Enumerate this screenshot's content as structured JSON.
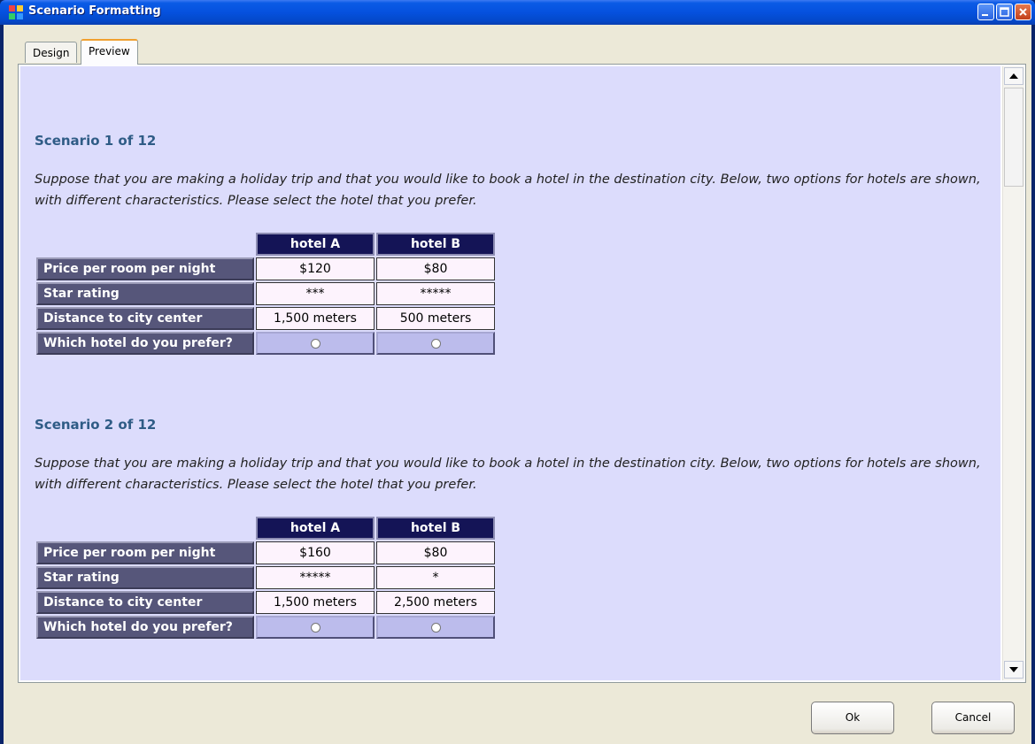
{
  "window": {
    "title": "Scenario Formatting"
  },
  "tabs": [
    {
      "label": "Design",
      "active": false
    },
    {
      "label": "Preview",
      "active": true
    }
  ],
  "scenarios": [
    {
      "title": "Scenario 1 of 12",
      "text": "Suppose that you are making a holiday trip and that you would like to book a hotel in the destination city. Below, two options for hotels are shown, with different characteristics. Please select the hotel that you prefer.",
      "headers": [
        "hotel A",
        "hotel B"
      ],
      "rows": [
        {
          "label": "Price per room per night",
          "values": [
            "$120",
            "$80"
          ]
        },
        {
          "label": "Star rating",
          "values": [
            "***",
            "*****"
          ]
        },
        {
          "label": "Distance to city center",
          "values": [
            "1,500 meters",
            "500 meters"
          ]
        }
      ],
      "choice_label": "Which hotel do you prefer?"
    },
    {
      "title": "Scenario 2 of 12",
      "text": "Suppose that you are making a holiday trip and that you would like to book a hotel in the destination city. Below, two options for hotels are shown, with different characteristics. Please select the hotel that you prefer.",
      "headers": [
        "hotel A",
        "hotel B"
      ],
      "rows": [
        {
          "label": "Price per room per night",
          "values": [
            "$160",
            "$80"
          ]
        },
        {
          "label": "Star rating",
          "values": [
            "*****",
            "*"
          ]
        },
        {
          "label": "Distance to city center",
          "values": [
            "1,500 meters",
            "2,500 meters"
          ]
        }
      ],
      "choice_label": "Which hotel do you prefer?"
    }
  ],
  "buttons": {
    "ok": "Ok",
    "cancel": "Cancel"
  },
  "icons": {
    "app": "app-icon",
    "minimize": "minimize-icon",
    "maximize": "maximize-icon",
    "close": "close-icon",
    "scroll_up": "arrow-up-icon",
    "scroll_down": "arrow-down-icon"
  },
  "colors": {
    "titlebar": "#0551de",
    "preview_bg": "#dcdcfc",
    "header_cell": "#141456",
    "row_label_cell": "#56567a",
    "value_cell": "#fdf3fd",
    "radio_cell": "#bcbcec",
    "scenario_title": "#2f5c86"
  }
}
